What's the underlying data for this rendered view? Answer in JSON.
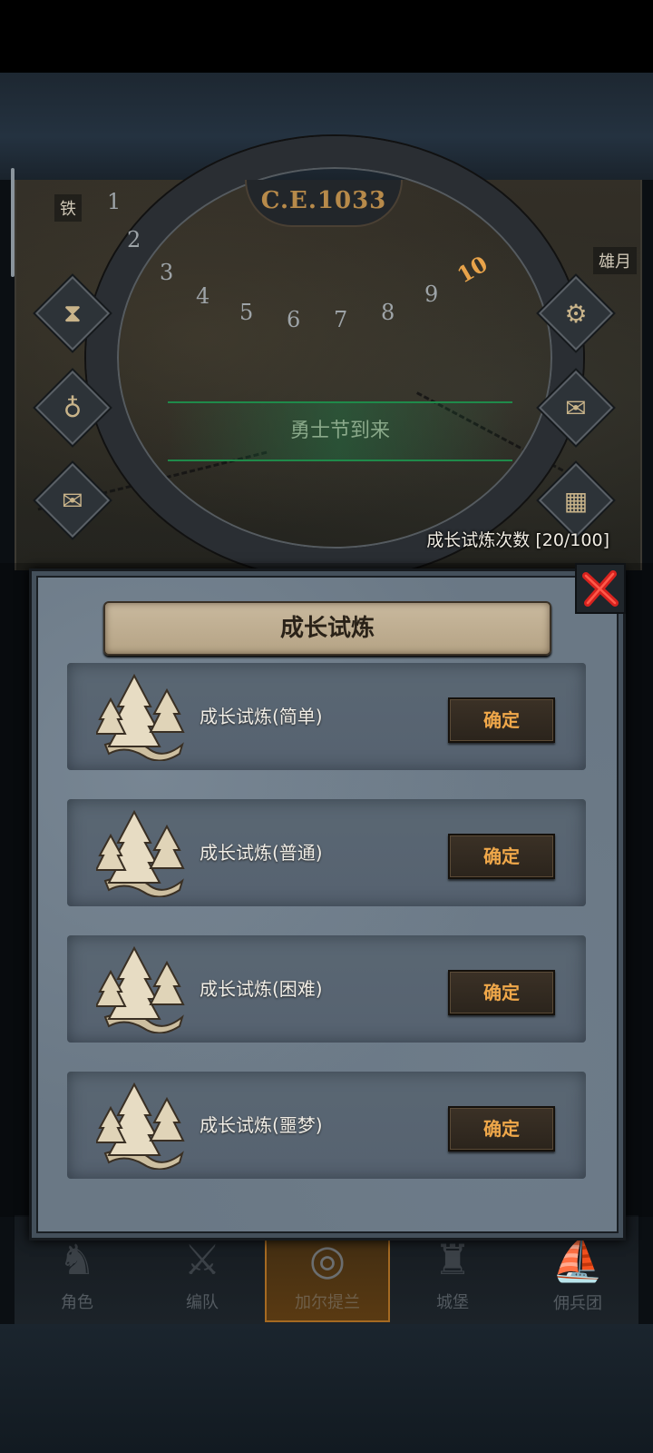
{
  "map": {
    "year_label": "C.E.1033",
    "ring_numbers": [
      "1",
      "2",
      "3",
      "4",
      "5",
      "6",
      "7",
      "8",
      "9",
      "10"
    ],
    "active_ring_number": "10",
    "label_left": "铁",
    "label_right": "雄月",
    "event_banner": "勇士节到来",
    "trials_count_text": "成长试炼次数 [20/100]"
  },
  "side_buttons": {
    "left": [
      "hourglass-icon",
      "money-bag-icon",
      "scroll-icon"
    ],
    "right": [
      "gear-icon",
      "mail-icon",
      "grid-icon"
    ]
  },
  "modal": {
    "title": "成长试炼",
    "trials": [
      {
        "label": "成长试炼(简单)",
        "button": "确定"
      },
      {
        "label": "成长试炼(普通)",
        "button": "确定"
      },
      {
        "label": "成长试炼(困难)",
        "button": "确定"
      },
      {
        "label": "成长试炼(噩梦)",
        "button": "确定"
      }
    ]
  },
  "bottom_nav": {
    "items": [
      {
        "label": "角色",
        "icon": "knight-icon"
      },
      {
        "label": "编队",
        "icon": "team-icon"
      },
      {
        "label": "加尔提兰",
        "icon": "globe-icon"
      },
      {
        "label": "城堡",
        "icon": "castle-icon"
      },
      {
        "label": "佣兵团",
        "icon": "ship-icon"
      }
    ],
    "active_index": 2
  },
  "colors": {
    "accent_orange": "#f0a84a",
    "close_red": "#d8221e",
    "banner_green": "#1f8a4a"
  }
}
